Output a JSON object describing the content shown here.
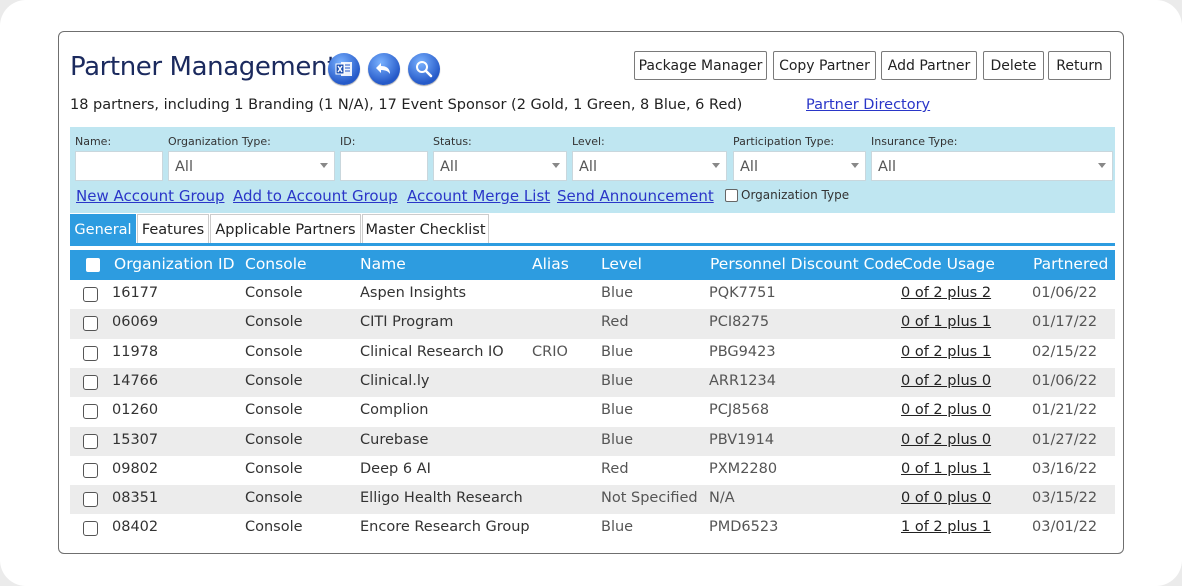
{
  "page": {
    "title": "Partner Management",
    "summary": "18 partners, including 1 Branding (1 N/A),  17 Event Sponsor (2 Gold, 1 Green, 8 Blue, 6 Red)",
    "directory_link": "Partner Directory"
  },
  "header_icons": [
    "excel-icon",
    "back-arrow-icon",
    "search-icon"
  ],
  "toolbar": {
    "package_manager": "Package Manager",
    "copy_partner": "Copy Partner",
    "add_partner": "Add Partner",
    "delete": "Delete",
    "return": "Return"
  },
  "filters": {
    "name_label": "Name:",
    "org_type_label": "Organization Type:",
    "org_type_value": "All",
    "id_label": "ID:",
    "status_label": "Status:",
    "status_value": "All",
    "level_label": "Level:",
    "level_value": "All",
    "participation_label": "Participation Type:",
    "participation_value": "All",
    "insurance_label": "Insurance Type:",
    "insurance_value": "All"
  },
  "actions": {
    "new_account_group": "New Account Group",
    "add_to_account_group": "Add to Account Group",
    "account_merge_list": "Account Merge List",
    "send_announcement": "Send Announcement",
    "org_type_checkbox": "Organization Type"
  },
  "tabs": [
    {
      "label": "General",
      "active": true
    },
    {
      "label": "Features",
      "active": false
    },
    {
      "label": "Applicable Partners",
      "active": false
    },
    {
      "label": "Master Checklist",
      "active": false
    }
  ],
  "table": {
    "headers": {
      "org_id": "Organization ID",
      "console": "Console",
      "name": "Name",
      "alias": "Alias",
      "level": "Level",
      "discount": "Personnel Discount Code",
      "usage": "Code Usage",
      "partnered": "Partnered"
    },
    "rows": [
      {
        "org_id": "16177",
        "console": "Console",
        "name": "Aspen Insights",
        "alias": "",
        "level": "Blue",
        "discount": "PQK7751",
        "usage": "0 of 2 plus 2",
        "partnered": "01/06/22"
      },
      {
        "org_id": "06069",
        "console": "Console",
        "name": "CITI Program",
        "alias": "",
        "level": "Red",
        "discount": "PCI8275",
        "usage": "0 of 1 plus 1",
        "partnered": "01/17/22"
      },
      {
        "org_id": "11978",
        "console": "Console",
        "name": "Clinical Research IO",
        "alias": "CRIO",
        "level": "Blue",
        "discount": "PBG9423",
        "usage": "0 of 2 plus 1",
        "partnered": "02/15/22"
      },
      {
        "org_id": "14766",
        "console": "Console",
        "name": "Clinical.ly",
        "alias": "",
        "level": "Blue",
        "discount": "ARR1234",
        "usage": "0 of 2 plus 0",
        "partnered": "01/06/22"
      },
      {
        "org_id": "01260",
        "console": "Console",
        "name": "Complion",
        "alias": "",
        "level": "Blue",
        "discount": "PCJ8568",
        "usage": "0 of 2 plus 0",
        "partnered": "01/21/22"
      },
      {
        "org_id": "15307",
        "console": "Console",
        "name": "Curebase",
        "alias": "",
        "level": "Blue",
        "discount": "PBV1914",
        "usage": "0 of 2 plus 0",
        "partnered": "01/27/22"
      },
      {
        "org_id": "09802",
        "console": "Console",
        "name": "Deep 6 AI",
        "alias": "",
        "level": "Red",
        "discount": "PXM2280",
        "usage": "0 of 1 plus 1",
        "partnered": "03/16/22"
      },
      {
        "org_id": "08351",
        "console": "Console",
        "name": "Elligo Health Research",
        "alias": "",
        "level": "Not Specified",
        "discount": "N/A",
        "usage": "0 of 0 plus 0",
        "partnered": "03/15/22"
      },
      {
        "org_id": "08402",
        "console": "Console",
        "name": "Encore Research Group",
        "alias": "",
        "level": "Blue",
        "discount": "PMD6523",
        "usage": "1 of 2 plus 1",
        "partnered": "03/01/22"
      }
    ]
  },
  "colors": {
    "accent": "#2d9ce0",
    "filter_bg": "#bfe6f1",
    "link": "#2a36c8",
    "title": "#1b2a5e"
  }
}
